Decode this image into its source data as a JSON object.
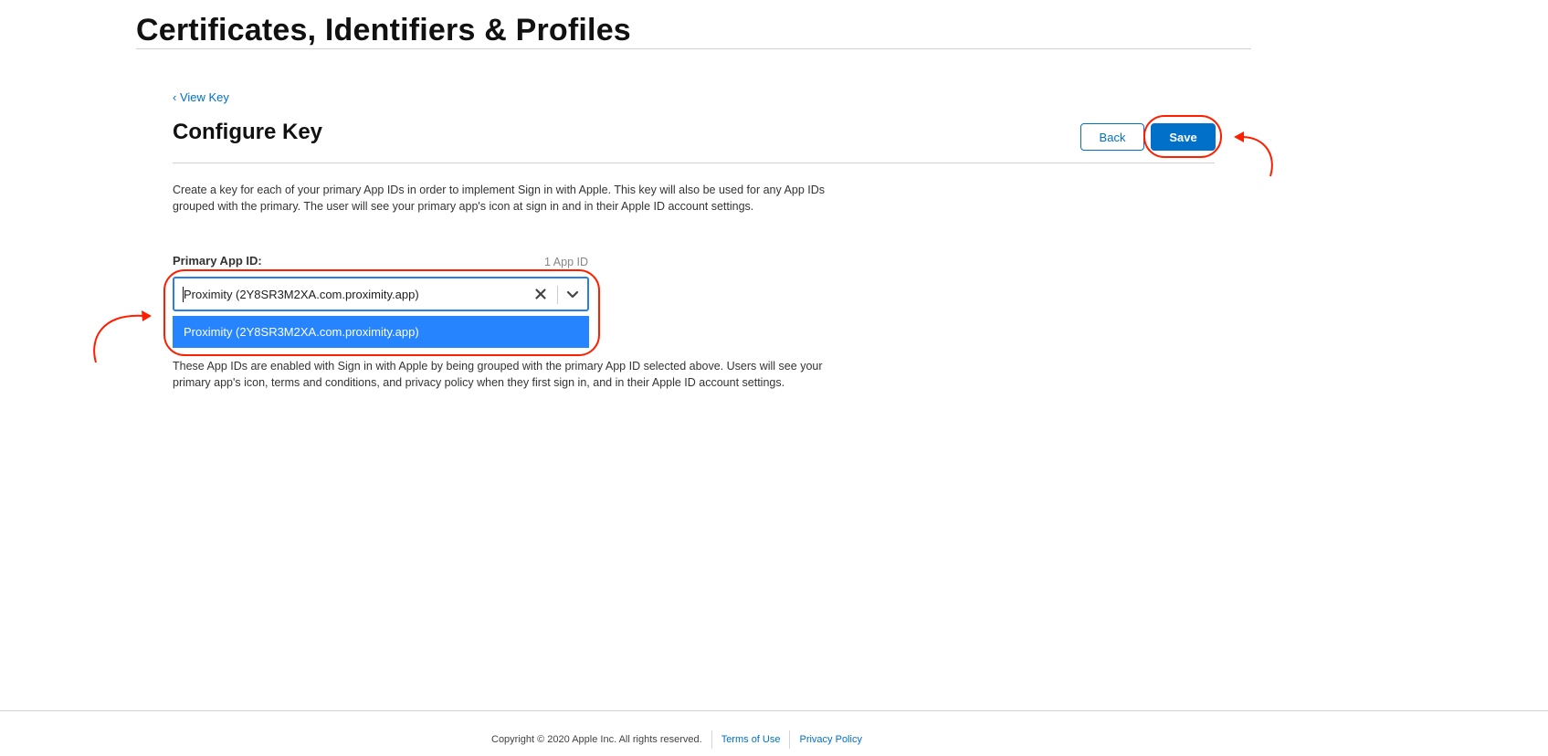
{
  "app": {
    "title": "Certificates, Identifiers & Profiles"
  },
  "breadcrumb": {
    "label": "‹ View Key"
  },
  "page": {
    "heading": "Configure Key",
    "description": "Create a key for each of your primary App IDs in order to implement Sign in with Apple. This key will also be used for any App IDs grouped with the primary. The user will see your primary app's icon at sign in and in their Apple ID account settings."
  },
  "actions": {
    "back_label": "Back",
    "save_label": "Save"
  },
  "primary_app_id": {
    "label": "Primary App ID:",
    "count": "1 App ID",
    "selected_value": "Proximity (2Y8SR3M2XA.com.proximity.app)",
    "options": [
      "Proximity (2Y8SR3M2XA.com.proximity.app)"
    ],
    "clear_icon": "close-icon",
    "expand_icon": "chevron-down-icon"
  },
  "grouped": {
    "description": "These App IDs are enabled with Sign in with Apple by being grouped with the primary App ID selected above. Users will see your primary app's icon, terms and conditions, and privacy policy when they first sign in, and in their Apple ID account settings."
  },
  "footer": {
    "copyright": "Copyright © 2020 Apple Inc. All rights reserved.",
    "terms": "Terms of Use",
    "privacy": "Privacy Policy"
  },
  "colors": {
    "accent": "#0070c9",
    "option_highlight": "#2684ff",
    "annotation": "#ff1f00"
  }
}
